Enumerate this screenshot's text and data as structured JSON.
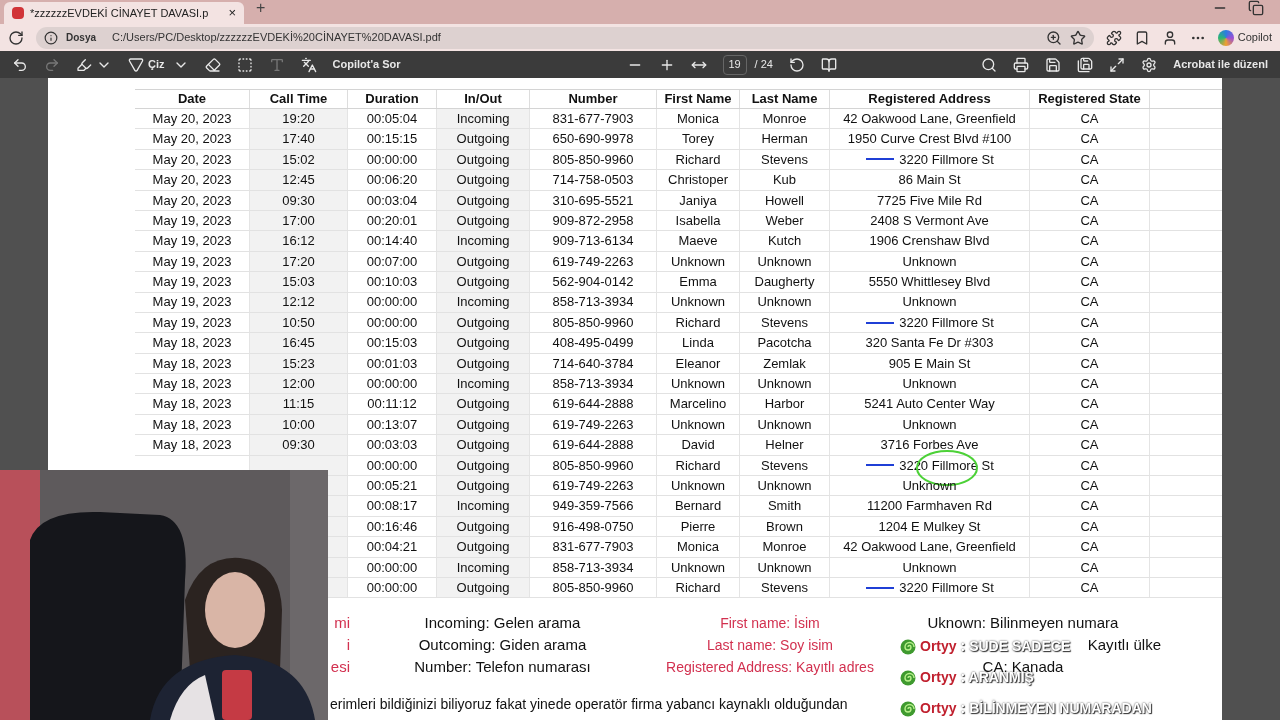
{
  "tab": {
    "title": "*zzzzzzEVDEKİ CİNAYET DAVASI.p",
    "close": "×",
    "new_tab": "+"
  },
  "address_bar": {
    "scheme": "Dosya",
    "url": "C:/Users/PC/Desktop/zzzzzzEVDEKİ%20CİNAYET%20DAVASI.pdf",
    "copilot": "Copilot"
  },
  "toolbar": {
    "draw": "Çiz",
    "ask": "Copilot'a Sor",
    "page": "19",
    "pages": "/ 24",
    "edit": "Acrobat ile düzenl"
  },
  "table": {
    "columns": [
      "Date",
      "Call Time",
      "Duration",
      "In/Out",
      "Number",
      "First Name",
      "Last Name",
      "Registered Address",
      "Registered State"
    ],
    "rows": [
      {
        "date": "May 20, 2023",
        "time": "19:20",
        "duration": "00:05:04",
        "dir": "Incoming",
        "number": "831-677-7903",
        "first": "Monica",
        "last": "Monroe",
        "address": "42 Oakwood Lane, Greenfield",
        "state": "CA",
        "marked": false,
        "circled": false
      },
      {
        "date": "May 20, 2023",
        "time": "17:40",
        "duration": "00:15:15",
        "dir": "Outgoing",
        "number": "650-690-9978",
        "first": "Torey",
        "last": "Herman",
        "address": "1950 Curve Crest Blvd #100",
        "state": "CA",
        "marked": false,
        "circled": false
      },
      {
        "date": "May 20, 2023",
        "time": "15:02",
        "duration": "00:00:00",
        "dir": "Outgoing",
        "number": "805-850-9960",
        "first": "Richard",
        "last": "Stevens",
        "address": "3220 Fillmore St",
        "state": "CA",
        "marked": true,
        "circled": false
      },
      {
        "date": "May 20, 2023",
        "time": "12:45",
        "duration": "00:06:20",
        "dir": "Outgoing",
        "number": "714-758-0503",
        "first": "Christoper",
        "last": "Kub",
        "address": "86 Main St",
        "state": "CA",
        "marked": false,
        "circled": false
      },
      {
        "date": "May 20, 2023",
        "time": "09:30",
        "duration": "00:03:04",
        "dir": "Outgoing",
        "number": "310-695-5521",
        "first": "Janiya",
        "last": "Howell",
        "address": "7725 Five Mile Rd",
        "state": "CA",
        "marked": false,
        "circled": false
      },
      {
        "date": "May 19, 2023",
        "time": "17:00",
        "duration": "00:20:01",
        "dir": "Outgoing",
        "number": "909-872-2958",
        "first": "Isabella",
        "last": "Weber",
        "address": "2408 S Vermont Ave",
        "state": "CA",
        "marked": false,
        "circled": false
      },
      {
        "date": "May 19, 2023",
        "time": "16:12",
        "duration": "00:14:40",
        "dir": "Incoming",
        "number": "909-713-6134",
        "first": "Maeve",
        "last": "Kutch",
        "address": "1906 Crenshaw Blvd",
        "state": "CA",
        "marked": false,
        "circled": false
      },
      {
        "date": "May 19, 2023",
        "time": "17:20",
        "duration": "00:07:00",
        "dir": "Outgoing",
        "number": "619-749-2263",
        "first": "Unknown",
        "last": "Unknown",
        "address": "Unknown",
        "state": "CA",
        "marked": false,
        "circled": false
      },
      {
        "date": "May 19, 2023",
        "time": "15:03",
        "duration": "00:10:03",
        "dir": "Outgoing",
        "number": "562-904-0142",
        "first": "Emma",
        "last": "Daugherty",
        "address": "5550 Whittlesey Blvd",
        "state": "CA",
        "marked": false,
        "circled": false
      },
      {
        "date": "May 19, 2023",
        "time": "12:12",
        "duration": "00:00:00",
        "dir": "Incoming",
        "number": "858-713-3934",
        "first": "Unknown",
        "last": "Unknown",
        "address": "Unknown",
        "state": "CA",
        "marked": false,
        "circled": false
      },
      {
        "date": "May 19, 2023",
        "time": "10:50",
        "duration": "00:00:00",
        "dir": "Outgoing",
        "number": "805-850-9960",
        "first": "Richard",
        "last": "Stevens",
        "address": "3220 Fillmore St",
        "state": "CA",
        "marked": true,
        "circled": false
      },
      {
        "date": "May 18, 2023",
        "time": "16:45",
        "duration": "00:15:03",
        "dir": "Outgoing",
        "number": "408-495-0499",
        "first": "Linda",
        "last": "Pacotcha",
        "address": "320 Santa Fe Dr #303",
        "state": "CA",
        "marked": false,
        "circled": false
      },
      {
        "date": "May 18, 2023",
        "time": "15:23",
        "duration": "00:01:03",
        "dir": "Outgoing",
        "number": "714-640-3784",
        "first": "Eleanor",
        "last": "Zemlak",
        "address": "905 E Main St",
        "state": "CA",
        "marked": false,
        "circled": false
      },
      {
        "date": "May 18, 2023",
        "time": "12:00",
        "duration": "00:00:00",
        "dir": "Incoming",
        "number": "858-713-3934",
        "first": "Unknown",
        "last": "Unknown",
        "address": "Unknown",
        "state": "CA",
        "marked": false,
        "circled": false
      },
      {
        "date": "May 18, 2023",
        "time": "11:15",
        "duration": "00:11:12",
        "dir": "Outgoing",
        "number": "619-644-2888",
        "first": "Marcelino",
        "last": "Harbor",
        "address": "5241 Auto Center Way",
        "state": "CA",
        "marked": false,
        "circled": false
      },
      {
        "date": "May 18, 2023",
        "time": "10:00",
        "duration": "00:13:07",
        "dir": "Outgoing",
        "number": "619-749-2263",
        "first": "Unknown",
        "last": "Unknown",
        "address": "Unknown",
        "state": "CA",
        "marked": false,
        "circled": false
      },
      {
        "date": "May 18, 2023",
        "time": "09:30",
        "duration": "00:03:03",
        "dir": "Outgoing",
        "number": "619-644-2888",
        "first": "David",
        "last": "Helner",
        "address": "3716 Forbes Ave",
        "state": "CA",
        "marked": false,
        "circled": false
      },
      {
        "duration": "00:00:00",
        "dir": "Outgoing",
        "number": "805-850-9960",
        "first": "Richard",
        "last": "Stevens",
        "address": "3220 Fillmore St",
        "state": "CA",
        "marked": true,
        "circled": true
      },
      {
        "duration": "00:05:21",
        "dir": "Outgoing",
        "number": "619-749-2263",
        "first": "Unknown",
        "last": "Unknown",
        "address": "Unknown",
        "state": "CA",
        "marked": false,
        "circled": false
      },
      {
        "duration": "00:08:17",
        "dir": "Incoming",
        "number": "949-359-7566",
        "first": "Bernard",
        "last": "Smith",
        "address": "11200 Farmhaven Rd",
        "state": "CA",
        "marked": false,
        "circled": false
      },
      {
        "duration": "00:16:46",
        "dir": "Outgoing",
        "number": "916-498-0750",
        "first": "Pierre",
        "last": "Brown",
        "address": "1204 E Mulkey St",
        "state": "CA",
        "marked": false,
        "circled": false
      },
      {
        "duration": "00:04:21",
        "dir": "Outgoing",
        "number": "831-677-7903",
        "first": "Monica",
        "last": "Monroe",
        "address": "42 Oakwood Lane, Greenfield",
        "state": "CA",
        "marked": false,
        "circled": false
      },
      {
        "duration": "00:00:00",
        "dir": "Incoming",
        "number": "858-713-3934",
        "first": "Unknown",
        "last": "Unknown",
        "address": "Unknown",
        "state": "CA",
        "marked": false,
        "circled": false
      },
      {
        "duration": "00:00:00",
        "dir": "Outgoing",
        "number": "805-850-9960",
        "first": "Richard",
        "last": "Stevens",
        "address": "3220 Fillmore St",
        "state": "CA",
        "marked": true,
        "circled": false
      }
    ]
  },
  "legend": {
    "columns": [
      {
        "kind": "red",
        "lines": [
          "mi",
          "i",
          "esi"
        ]
      },
      {
        "kind": "black",
        "lines": [
          "Incoming: Gelen arama",
          "Outcoming: Giden arama",
          "Number: Telefon numarası"
        ]
      },
      {
        "kind": "red",
        "lines": [
          "First name: İsim",
          "Last name: Soy isim",
          "Registered Address: Kayıtlı adres"
        ]
      },
      {
        "kind": "black",
        "lines": [
          "Uknown: Bilinmeyen numara",
          "Kayıtlı ülke",
          "CA: Kanada"
        ]
      }
    ],
    "note": "erimleri bildiğinizi biliyoruz fakat yinede operatör firma yabancı kaynaklı olduğundan"
  },
  "chat": [
    {
      "user": "Ortyy",
      "message": ": SUDE SADECE"
    },
    {
      "user": "Ortyy",
      "message": ": ARANMIŞ"
    },
    {
      "user": "Ortyy",
      "message": ": BİLİNMEYEN NUMARADAN"
    }
  ]
}
